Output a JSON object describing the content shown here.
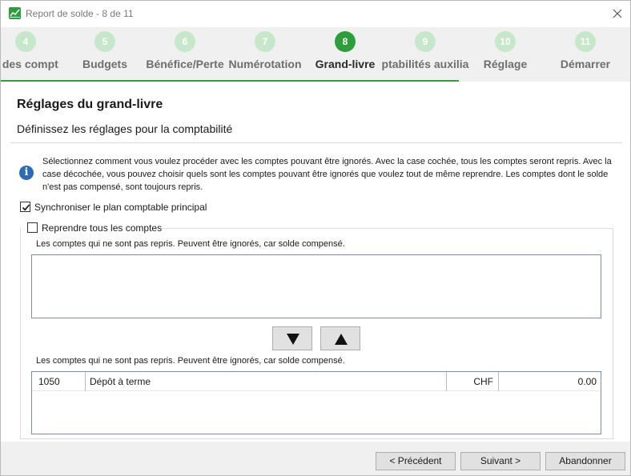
{
  "window": {
    "title": "Report de solde - 8 de 11"
  },
  "steps": [
    {
      "number": "4",
      "label": "s des compt"
    },
    {
      "number": "5",
      "label": "Budgets"
    },
    {
      "number": "6",
      "label": "Bénéfice/Perte"
    },
    {
      "number": "7",
      "label": "Numérotation"
    },
    {
      "number": "8",
      "label": "Grand-livre"
    },
    {
      "number": "9",
      "label": "ptabilités auxilia"
    },
    {
      "number": "10",
      "label": "Réglage"
    },
    {
      "number": "11",
      "label": "Démarrer"
    }
  ],
  "active_step": "8",
  "header": {
    "title": "Réglages du grand-livre",
    "subtitle": "Définissez les réglages pour la comptabilité"
  },
  "info": {
    "text": "Sélectionnez comment vous voulez procéder avec les comptes pouvant être ignorés. Avec la case cochée, tous les comptes seront repris. Avec la case décochée, vous pouvez choisir quels sont les comptes pouvant être ignorés que voulez tout de même reprendre. Les comptes dont le solde n'est pas compensé, sont toujours repris."
  },
  "options": {
    "sync_label": "Synchroniser le plan comptable principal",
    "sync_checked": true,
    "take_all_label": "Reprendre tous les comptes",
    "take_all_checked": false
  },
  "lists": {
    "top_caption": "Les comptes qui ne sont pas repris. Peuvent être ignorés, car solde compensé.",
    "bottom_caption": "Les comptes qui ne sont pas repris. Peuvent être ignorés, car solde compensé.",
    "bottom_rows": [
      {
        "account": "1050",
        "description": "Dépôt à terme",
        "currency": "CHF",
        "amount": "0.00"
      }
    ]
  },
  "footer": {
    "previous_label": "< Précédent",
    "next_label": "Suivant >",
    "cancel_label": "Abandonner"
  },
  "colors": {
    "accent": "#2e9e3d",
    "step_inactive": "#c6e7c9",
    "info_icon": "#2b6ab5"
  }
}
